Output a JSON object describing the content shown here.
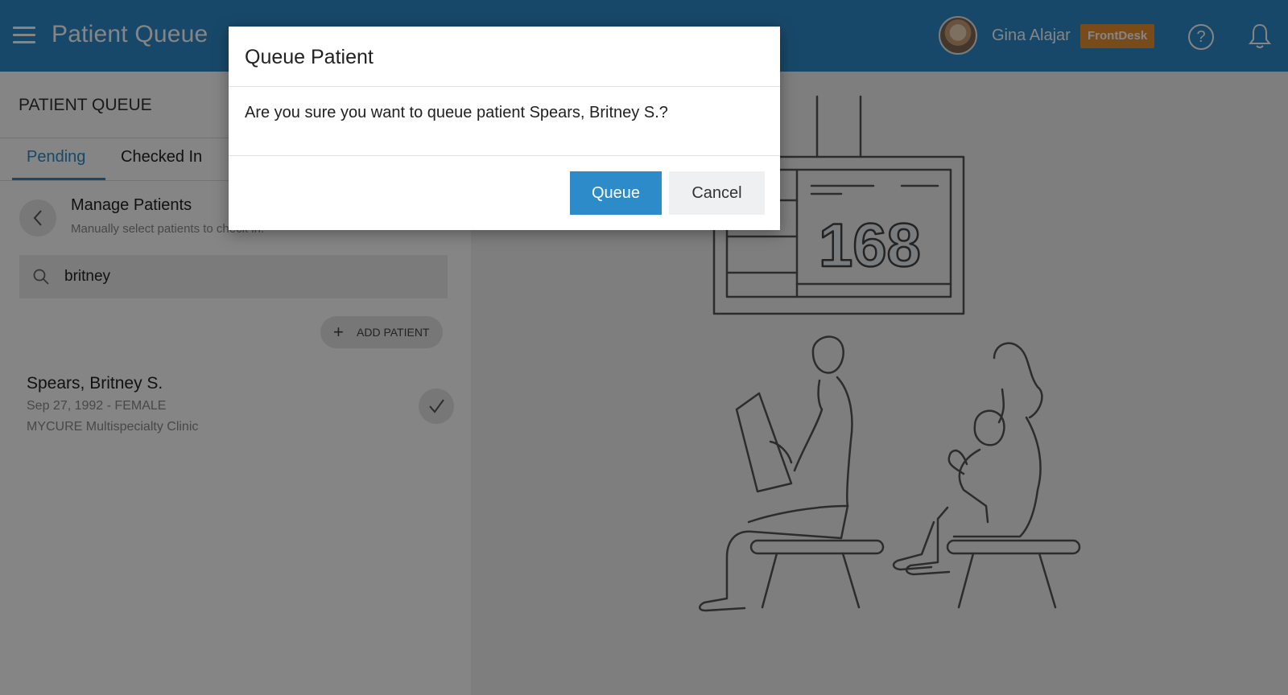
{
  "header": {
    "title": "Patient Queue",
    "user_name": "Gina Alajar",
    "role_badge": "FrontDesk",
    "help_glyph": "?",
    "brand_color": "#2e8bc9",
    "badge_color": "#e8902f"
  },
  "panel": {
    "title": "PATIENT QUEUE",
    "tabs": [
      {
        "label": "Pending",
        "active": true
      },
      {
        "label": "Checked In",
        "active": false
      }
    ],
    "section_title": "Manage Patients",
    "section_subtitle": "Manually select patients to check in.",
    "search": {
      "value": "britney"
    },
    "add_patient_label": "ADD PATIENT",
    "patients": [
      {
        "name": "Spears, Britney S.",
        "details": "Sep 27, 1992 - FEMALE",
        "clinic": "MYCURE Multispecialty Clinic"
      }
    ]
  },
  "illustration": {
    "display_number": "168"
  },
  "dialog": {
    "title": "Queue Patient",
    "message": "Are you sure you want to queue patient Spears, Britney S.?",
    "confirm_label": "Queue",
    "cancel_label": "Cancel"
  },
  "icons": [
    "menu-icon",
    "avatar",
    "help-icon",
    "bell-icon",
    "back-arrow-icon",
    "search-icon",
    "plus-icon",
    "check-icon"
  ]
}
